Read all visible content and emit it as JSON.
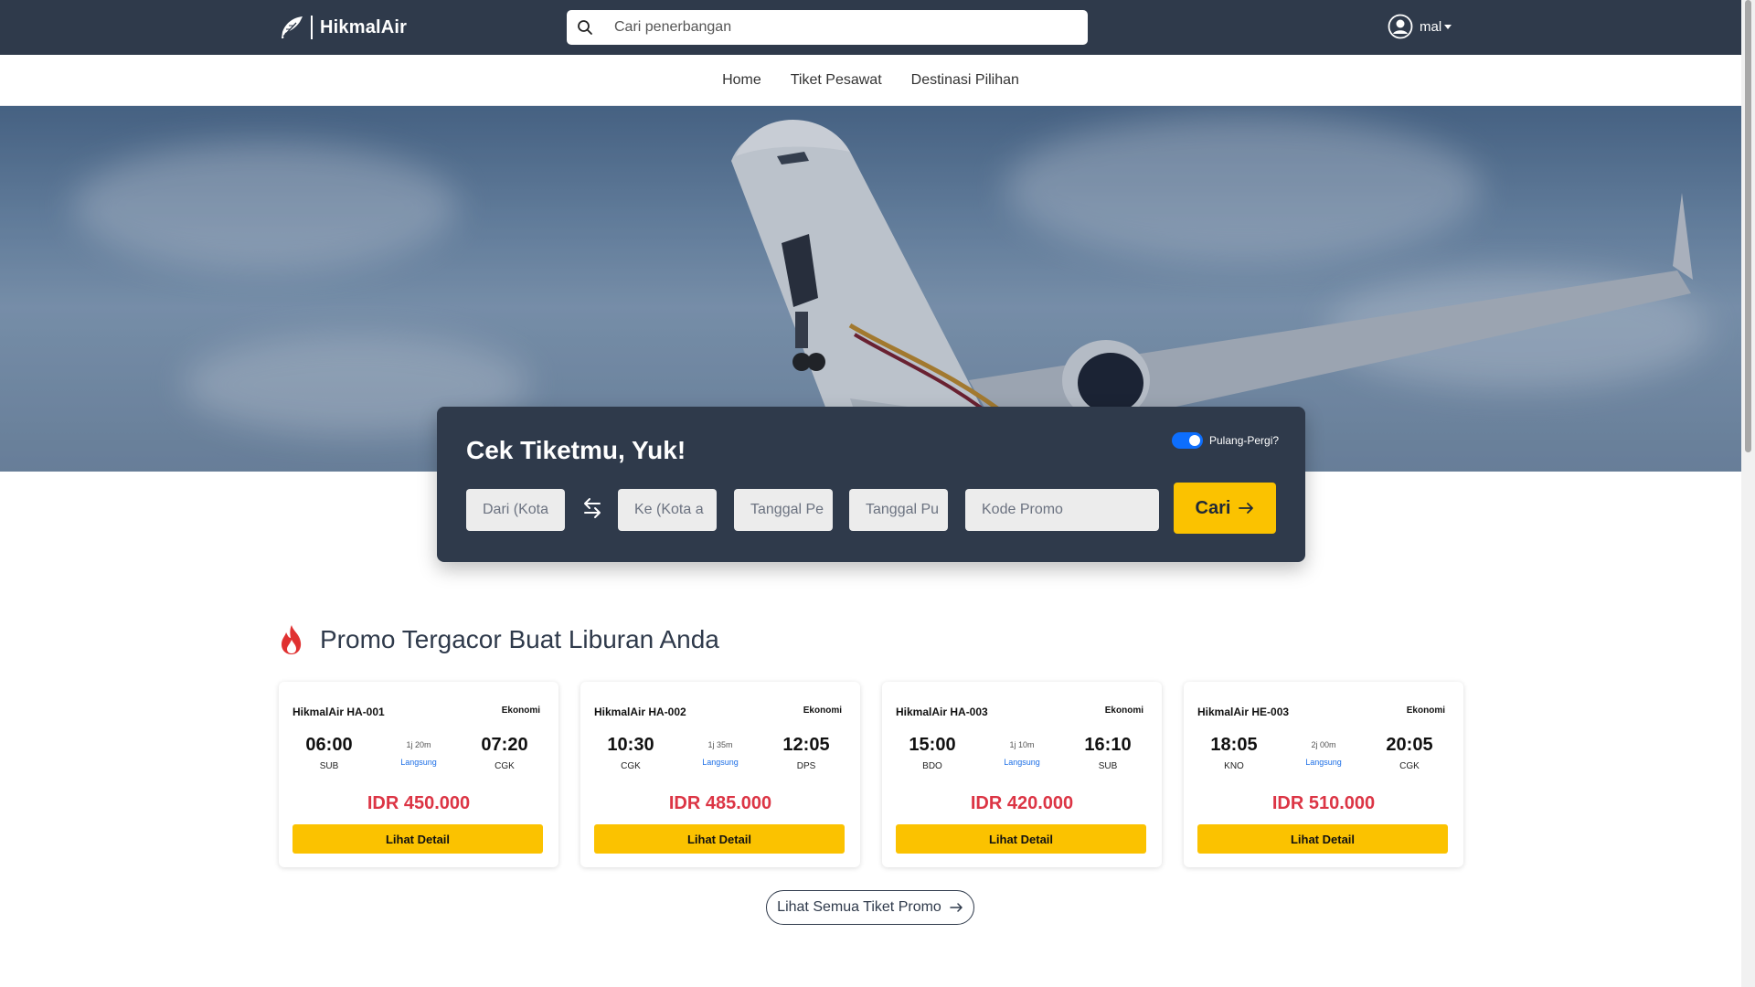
{
  "header": {
    "brand": "HikmalAir",
    "search_placeholder": "Cari penerbangan",
    "user_name": "mal"
  },
  "nav": {
    "items": [
      {
        "label": "Home"
      },
      {
        "label": "Tiket Pesawat"
      },
      {
        "label": "Destinasi Pilihan"
      }
    ]
  },
  "booking": {
    "title": "Cek Tiketmu, Yuk!",
    "roundtrip_label": "Pulang-Pergi?",
    "roundtrip_enabled": true,
    "from_placeholder": "Dari (Kota",
    "to_placeholder": "Ke (Kota a",
    "depart_placeholder": "Tanggal Pe",
    "return_placeholder": "Tanggal Pu",
    "promo_placeholder": "Kode Promo",
    "search_button": "Cari"
  },
  "promo": {
    "title": "Promo Tergacor Buat Liburan Anda",
    "cards": [
      {
        "flight": "HikmalAir HA-001",
        "class": "Ekonomi",
        "dep_time": "06:00",
        "dep_code": "SUB",
        "duration": "1j 20m",
        "type": "Langsung",
        "arr_time": "07:20",
        "arr_code": "CGK",
        "price": "IDR 450.000",
        "button": "Lihat Detail"
      },
      {
        "flight": "HikmalAir HA-002",
        "class": "Ekonomi",
        "dep_time": "10:30",
        "dep_code": "CGK",
        "duration": "1j 35m",
        "type": "Langsung",
        "arr_time": "12:05",
        "arr_code": "DPS",
        "price": "IDR 485.000",
        "button": "Lihat Detail"
      },
      {
        "flight": "HikmalAir HA-003",
        "class": "Ekonomi",
        "dep_time": "15:00",
        "dep_code": "BDO",
        "duration": "1j 10m",
        "type": "Langsung",
        "arr_time": "16:10",
        "arr_code": "SUB",
        "price": "IDR 420.000",
        "button": "Lihat Detail"
      },
      {
        "flight": "HikmalAir HE-003",
        "class": "Ekonomi",
        "dep_time": "18:05",
        "dep_code": "KNO",
        "duration": "2j 00m",
        "type": "Langsung",
        "arr_time": "20:05",
        "arr_code": "CGK",
        "price": "IDR 510.000",
        "button": "Lihat Detail"
      }
    ],
    "all_button": "Lihat Semua Tiket Promo"
  },
  "colors": {
    "navbar": "#2f3a4b",
    "accent": "#fbc200",
    "price": "#dc3545",
    "toggle": "#0d6efd"
  }
}
